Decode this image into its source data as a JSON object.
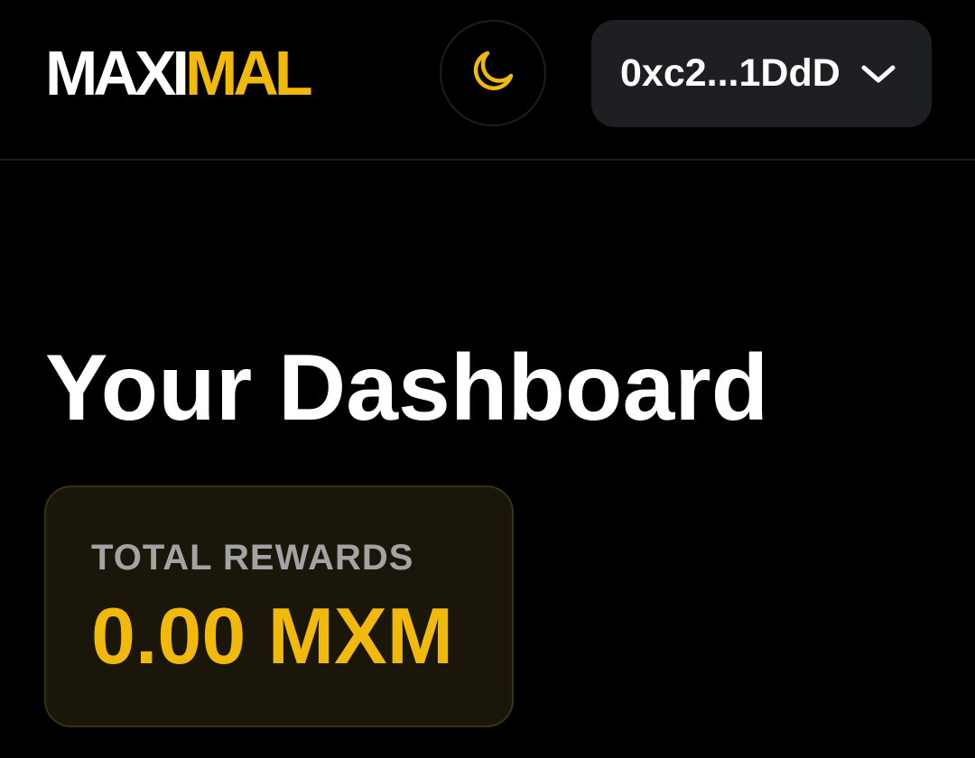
{
  "header": {
    "logo": {
      "part1": "MAXI",
      "part2": "MAL"
    },
    "theme_toggle": {
      "icon": "moon-icon"
    },
    "wallet": {
      "address": "0xc2...1DdD",
      "icon": "chevron-down-icon"
    }
  },
  "main": {
    "title": "Your Dashboard",
    "rewards": {
      "label": "TOTAL REWARDS",
      "value": "0.00 MXM"
    }
  },
  "colors": {
    "background": "#000000",
    "accent": "#f0b90b",
    "wallet_button": "#1e1f22",
    "card_background": "#1a160a",
    "card_border": "#3a3112",
    "muted_text": "#a3a3a3"
  }
}
